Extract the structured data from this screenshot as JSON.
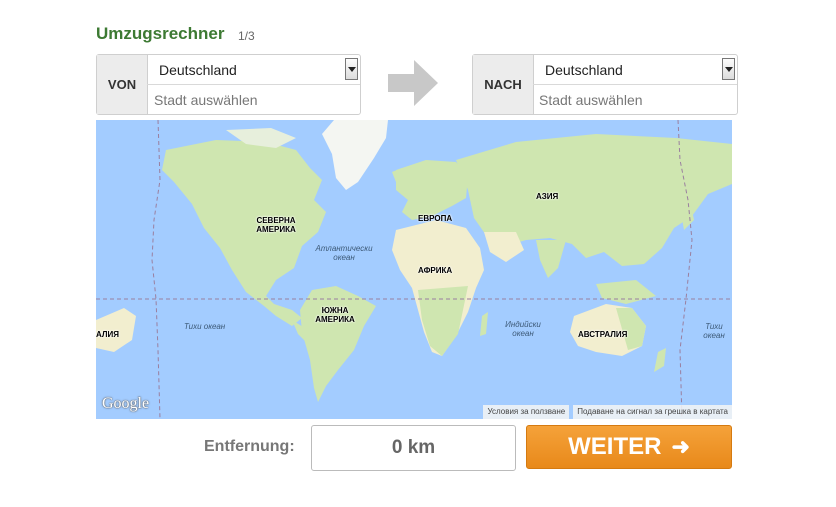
{
  "header": {
    "title": "Umzugsrechner",
    "step": "1/3"
  },
  "from": {
    "label": "VON",
    "country": "Deutschland",
    "city_placeholder": "Stadt auswählen"
  },
  "to": {
    "label": "NACH",
    "country": "Deutschland",
    "city_placeholder": "Stadt auswählen"
  },
  "map": {
    "labels": {
      "north_america": "СЕВЕРНА АМЕРИКА",
      "south_america": "ЮЖНА АМЕРИКА",
      "europe": "ЕВРОПА",
      "asia": "АЗИЯ",
      "africa": "АФРИКА",
      "australia": "АВСТРАЛИЯ",
      "australia_left": "АЛИЯ",
      "atlantic": "Атлантически океан",
      "pacific_left": "Тихи океан",
      "pacific_right": "Тихи океан",
      "indian": "Индийски океан"
    },
    "logo": "Google",
    "footer_terms": "Условия за ползване",
    "footer_report": "Подаване на сигнал за грешка в картата",
    "colors": {
      "water": "#a3ccff",
      "land": "#cfe6b0",
      "ice": "#f4f6f2",
      "desert": "#f2eecf"
    }
  },
  "distance": {
    "label": "Entfernung:",
    "value": "0 km"
  },
  "next_button": {
    "label": "WEITER",
    "arrow": "➜",
    "color": "#ee9424"
  }
}
